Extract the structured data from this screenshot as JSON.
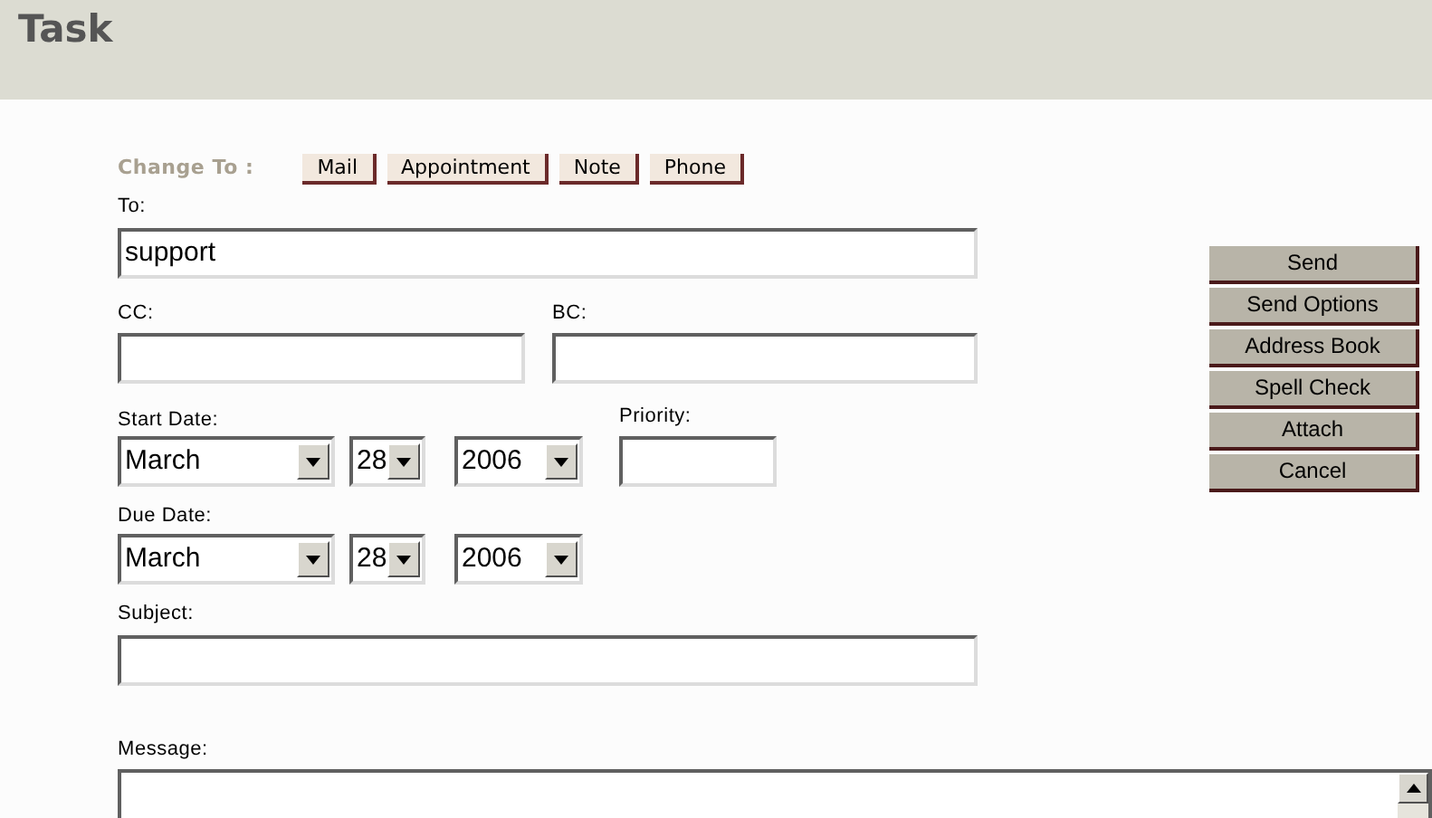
{
  "title": "Task",
  "change_to": {
    "label": "Change To :",
    "types": [
      "Mail",
      "Appointment",
      "Note",
      "Phone"
    ]
  },
  "to": {
    "label": "To:",
    "value": "support"
  },
  "cc": {
    "label": "CC:"
  },
  "bc": {
    "label": "BC:"
  },
  "start_date": {
    "label": "Start Date:",
    "month": "March",
    "day": "28",
    "year": "2006"
  },
  "priority": {
    "label": "Priority:"
  },
  "due_date": {
    "label": "Due Date:",
    "month": "March",
    "day": "28",
    "year": "2006"
  },
  "subject": {
    "label": "Subject:"
  },
  "message": {
    "label": "Message:"
  },
  "actions": [
    "Send",
    "Send Options",
    "Address Book",
    "Spell Check",
    "Attach",
    "Cancel"
  ]
}
